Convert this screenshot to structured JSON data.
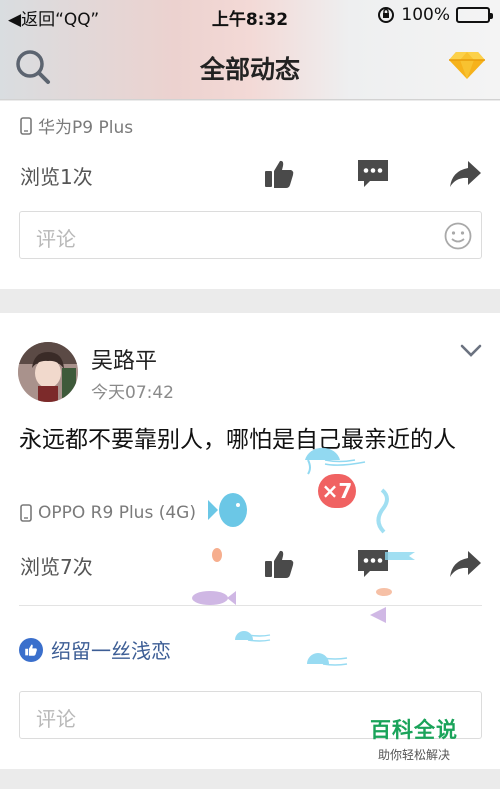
{
  "status_bar": {
    "back": "◀返回“QQ”",
    "time": "上午8:32",
    "battery": "100%"
  },
  "nav": {
    "title": "全部动态"
  },
  "card1": {
    "device": "华为P9 Plus",
    "views": "浏览1次",
    "comment_placeholder": "评论"
  },
  "card2": {
    "user_name": "吴路平",
    "time": "今天07:42",
    "text": "永远都不要靠别人，哪怕是自己最亲近的人",
    "device": "OPPO R9 Plus (4G)",
    "views": "浏览7次",
    "liker": "绍留一丝浅恋",
    "comment_placeholder": "评论"
  },
  "effect": {
    "multiplier": "×7"
  },
  "watermark": {
    "title": "百科全说",
    "subtitle": "助你轻松解决"
  },
  "colors": {
    "accent_blue": "#3a6fcc",
    "icon_gray": "#4a4a4a",
    "badge_red": "#f06262",
    "watermark_green": "#1aa35a"
  }
}
